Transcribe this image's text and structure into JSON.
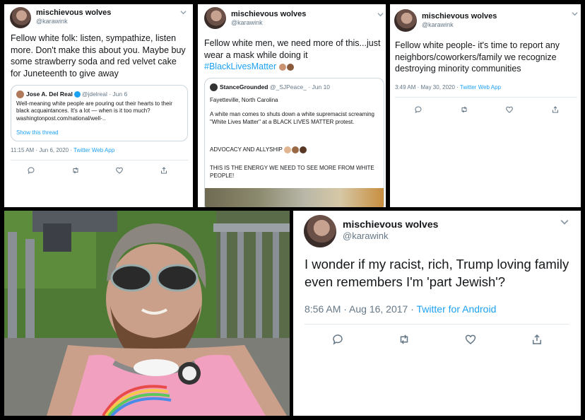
{
  "tweets": [
    {
      "name": "mischievous wolves",
      "handle": "@karawink",
      "text": "Fellow white folk: listen, sympathize, listen more. Don't make this about you. Maybe buy some strawberry soda and red velvet cake for Juneteenth to give away",
      "quote": {
        "name": "Jose A. Del Real",
        "handle": "@jdelreal · Jun 6",
        "text": "Well-meaning white people are pouring out their hearts to their black acquaintances. It's a lot — when is it too much? washingtonpost.com/national/well-..",
        "link": "Show this thread"
      },
      "time": "11:15 AM · Jun 6, 2020 · ",
      "app": "Twitter Web App"
    },
    {
      "name": "mischievous wolves",
      "handle": "@karawink",
      "text": "Fellow white men, we need more of this...just wear a mask while doing it ",
      "hashtag": "#BlackLivesMatter",
      "quote": {
        "name": "StanceGrounded",
        "handle": "@_SJPeace_ · Jun 10",
        "line1": "Fayetteville, North Carolina",
        "line2": "A white man comes to shuts down a white supremacist screaming \"White Lives Matter\" at a BLACK LIVES MATTER protest.",
        "line3": "ADVOCACY AND ALLYSHIP",
        "line4": "THIS IS THE ENERGY WE NEED TO SEE MORE FROM WHITE PEOPLE!"
      }
    },
    {
      "name": "mischievous wolves",
      "handle": "@karawink",
      "text": "Fellow white people- it's time to report any neighbors/coworkers/family we recognize destroying minority communities",
      "time": "3:49 AM · May 30, 2020 · ",
      "app": "Twitter Web App"
    },
    {
      "name": "mischievous wolves",
      "handle": "@karawink",
      "text": "I wonder if my racist, rich, Trump loving family even remembers I'm 'part Jewish'?",
      "time": "8:56 AM · Aug 16, 2017 · ",
      "app": "Twitter for Android"
    }
  ],
  "icons": {
    "chevron": "chevron-down-icon",
    "reply": "reply-icon",
    "retweet": "retweet-icon",
    "like": "like-icon",
    "share": "share-icon"
  },
  "colors": {
    "link": "#1da1f2",
    "meta": "#657786",
    "shirt": "#f2a0c0"
  }
}
